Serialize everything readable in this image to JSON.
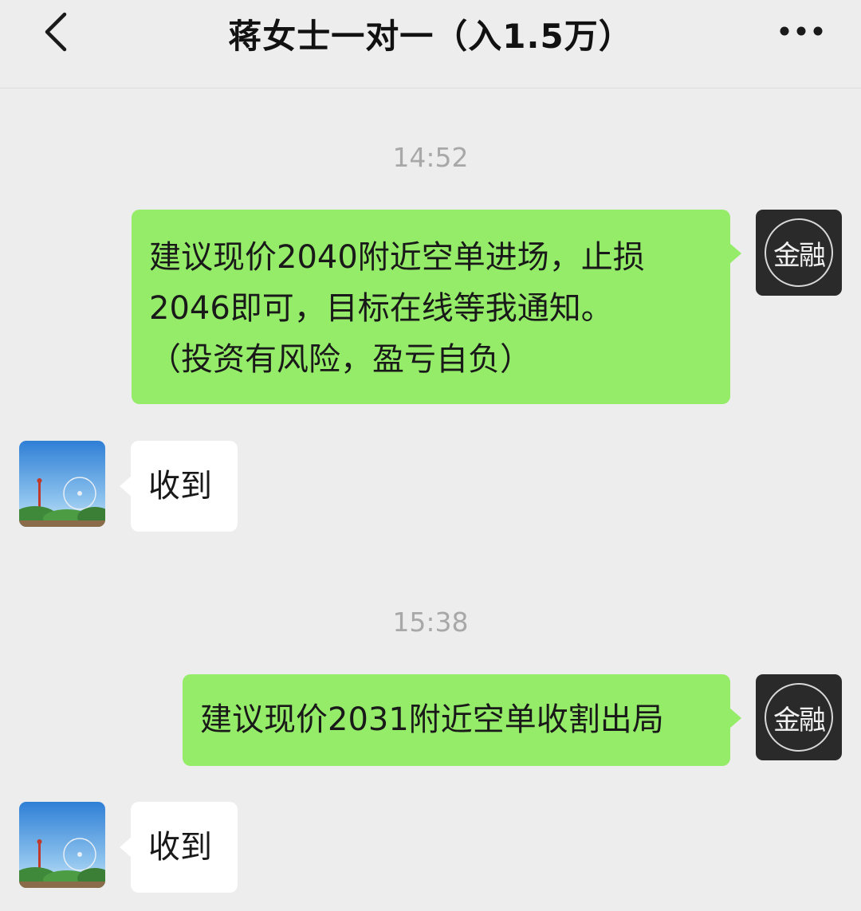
{
  "header": {
    "title": "蒋女士一对一（入1.5万）"
  },
  "self_avatar_text": "金融",
  "messages": [
    {
      "type": "time",
      "text": "14:52"
    },
    {
      "type": "sent",
      "lines": [
        "建议现价2040附近空单进场，止损",
        "2046即可，目标在线等我通知。",
        "（投资有风险，盈亏自负）"
      ]
    },
    {
      "type": "recv",
      "text": "收到"
    },
    {
      "type": "time",
      "text": "15:38"
    },
    {
      "type": "sent",
      "lines": [
        "建议现价2031附近空单收割出局"
      ]
    },
    {
      "type": "recv",
      "text": "收到"
    }
  ],
  "colors": {
    "sent_bubble": "#95ec69",
    "recv_bubble": "#ffffff",
    "background": "#ededed",
    "timestamp": "#a8a8a8"
  },
  "icons": {
    "back": "chevron-left-icon",
    "more": "more-dots-icon"
  }
}
